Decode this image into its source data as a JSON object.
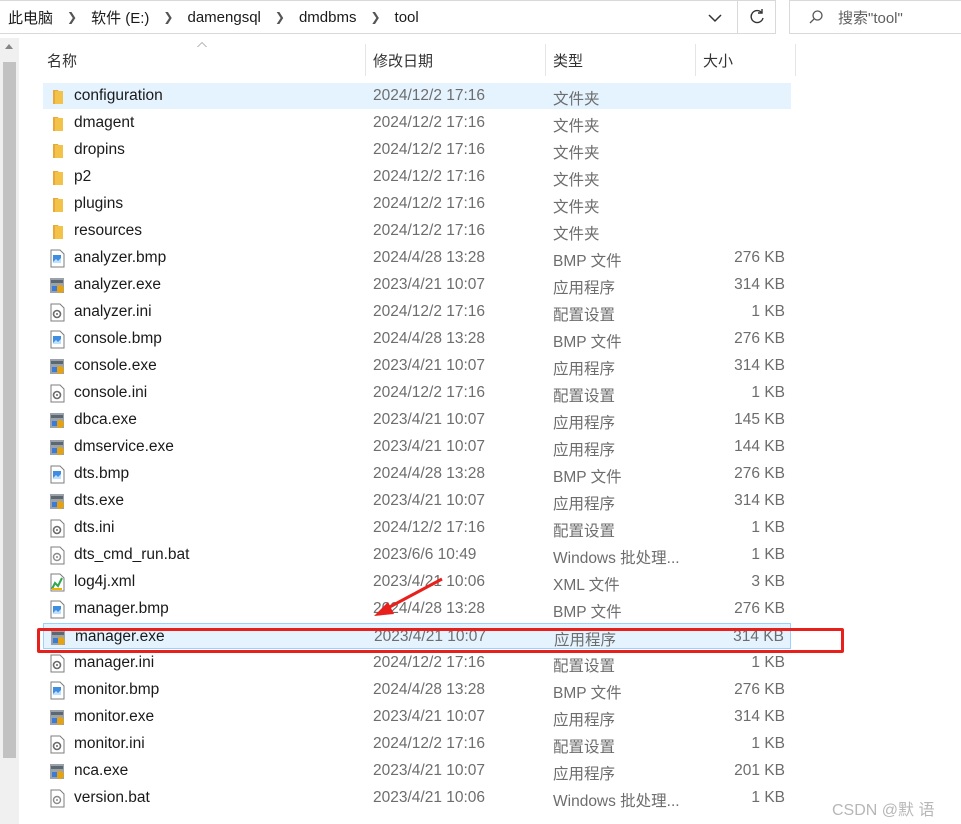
{
  "address": {
    "crumbs": [
      "此电脑",
      "软件 (E:)",
      "damengsql",
      "dmdbms",
      "tool"
    ]
  },
  "search": {
    "placeholder": "搜索\"tool\""
  },
  "columns": {
    "name": "名称",
    "date": "修改日期",
    "type": "类型",
    "size": "大小"
  },
  "files": [
    {
      "name": "configuration",
      "date": "2024/12/2 17:16",
      "type": "文件夹",
      "size": "",
      "icon": "folder-icon"
    },
    {
      "name": "dmagent",
      "date": "2024/12/2 17:16",
      "type": "文件夹",
      "size": "",
      "icon": "folder-icon"
    },
    {
      "name": "dropins",
      "date": "2024/12/2 17:16",
      "type": "文件夹",
      "size": "",
      "icon": "folder-icon"
    },
    {
      "name": "p2",
      "date": "2024/12/2 17:16",
      "type": "文件夹",
      "size": "",
      "icon": "folder-icon"
    },
    {
      "name": "plugins",
      "date": "2024/12/2 17:16",
      "type": "文件夹",
      "size": "",
      "icon": "folder-icon"
    },
    {
      "name": "resources",
      "date": "2024/12/2 17:16",
      "type": "文件夹",
      "size": "",
      "icon": "folder-icon"
    },
    {
      "name": "analyzer.bmp",
      "date": "2024/4/28 13:28",
      "type": "BMP 文件",
      "size": "276 KB",
      "icon": "bmp-file-icon"
    },
    {
      "name": "analyzer.exe",
      "date": "2023/4/21 10:07",
      "type": "应用程序",
      "size": "314 KB",
      "icon": "exe-file-icon"
    },
    {
      "name": "analyzer.ini",
      "date": "2024/12/2 17:16",
      "type": "配置设置",
      "size": "1 KB",
      "icon": "ini-file-icon"
    },
    {
      "name": "console.bmp",
      "date": "2024/4/28 13:28",
      "type": "BMP 文件",
      "size": "276 KB",
      "icon": "bmp-file-icon"
    },
    {
      "name": "console.exe",
      "date": "2023/4/21 10:07",
      "type": "应用程序",
      "size": "314 KB",
      "icon": "exe-file-icon"
    },
    {
      "name": "console.ini",
      "date": "2024/12/2 17:16",
      "type": "配置设置",
      "size": "1 KB",
      "icon": "ini-file-icon"
    },
    {
      "name": "dbca.exe",
      "date": "2023/4/21 10:07",
      "type": "应用程序",
      "size": "145 KB",
      "icon": "exe-file-icon"
    },
    {
      "name": "dmservice.exe",
      "date": "2023/4/21 10:07",
      "type": "应用程序",
      "size": "144 KB",
      "icon": "exe-file-icon"
    },
    {
      "name": "dts.bmp",
      "date": "2024/4/28 13:28",
      "type": "BMP 文件",
      "size": "276 KB",
      "icon": "bmp-file-icon"
    },
    {
      "name": "dts.exe",
      "date": "2023/4/21 10:07",
      "type": "应用程序",
      "size": "314 KB",
      "icon": "exe-file-icon"
    },
    {
      "name": "dts.ini",
      "date": "2024/12/2 17:16",
      "type": "配置设置",
      "size": "1 KB",
      "icon": "ini-file-icon"
    },
    {
      "name": "dts_cmd_run.bat",
      "date": "2023/6/6 10:49",
      "type": "Windows 批处理...",
      "size": "1 KB",
      "icon": "bat-file-icon"
    },
    {
      "name": "log4j.xml",
      "date": "2023/4/21 10:06",
      "type": "XML 文件",
      "size": "3 KB",
      "icon": "xml-file-icon"
    },
    {
      "name": "manager.bmp",
      "date": "2024/4/28 13:28",
      "type": "BMP 文件",
      "size": "276 KB",
      "icon": "bmp-file-icon"
    },
    {
      "name": "manager.exe",
      "date": "2023/4/21 10:07",
      "type": "应用程序",
      "size": "314 KB",
      "icon": "exe-file-icon"
    },
    {
      "name": "manager.ini",
      "date": "2024/12/2 17:16",
      "type": "配置设置",
      "size": "1 KB",
      "icon": "ini-file-icon"
    },
    {
      "name": "monitor.bmp",
      "date": "2024/4/28 13:28",
      "type": "BMP 文件",
      "size": "276 KB",
      "icon": "bmp-file-icon"
    },
    {
      "name": "monitor.exe",
      "date": "2023/4/21 10:07",
      "type": "应用程序",
      "size": "314 KB",
      "icon": "exe-file-icon"
    },
    {
      "name": "monitor.ini",
      "date": "2024/12/2 17:16",
      "type": "配置设置",
      "size": "1 KB",
      "icon": "ini-file-icon"
    },
    {
      "name": "nca.exe",
      "date": "2023/4/21 10:07",
      "type": "应用程序",
      "size": "201 KB",
      "icon": "exe-file-icon"
    },
    {
      "name": "version.bat",
      "date": "2023/4/21 10:06",
      "type": "Windows 批处理...",
      "size": "1 KB",
      "icon": "bat-file-icon"
    }
  ],
  "highlight_file": "manager.exe",
  "watermark": "CSDN @默  语",
  "colors": {
    "selection": "#e5f3ff",
    "selection_border": "#99d1ff",
    "annotation": "#e8201c",
    "folder": "#f3c349"
  }
}
